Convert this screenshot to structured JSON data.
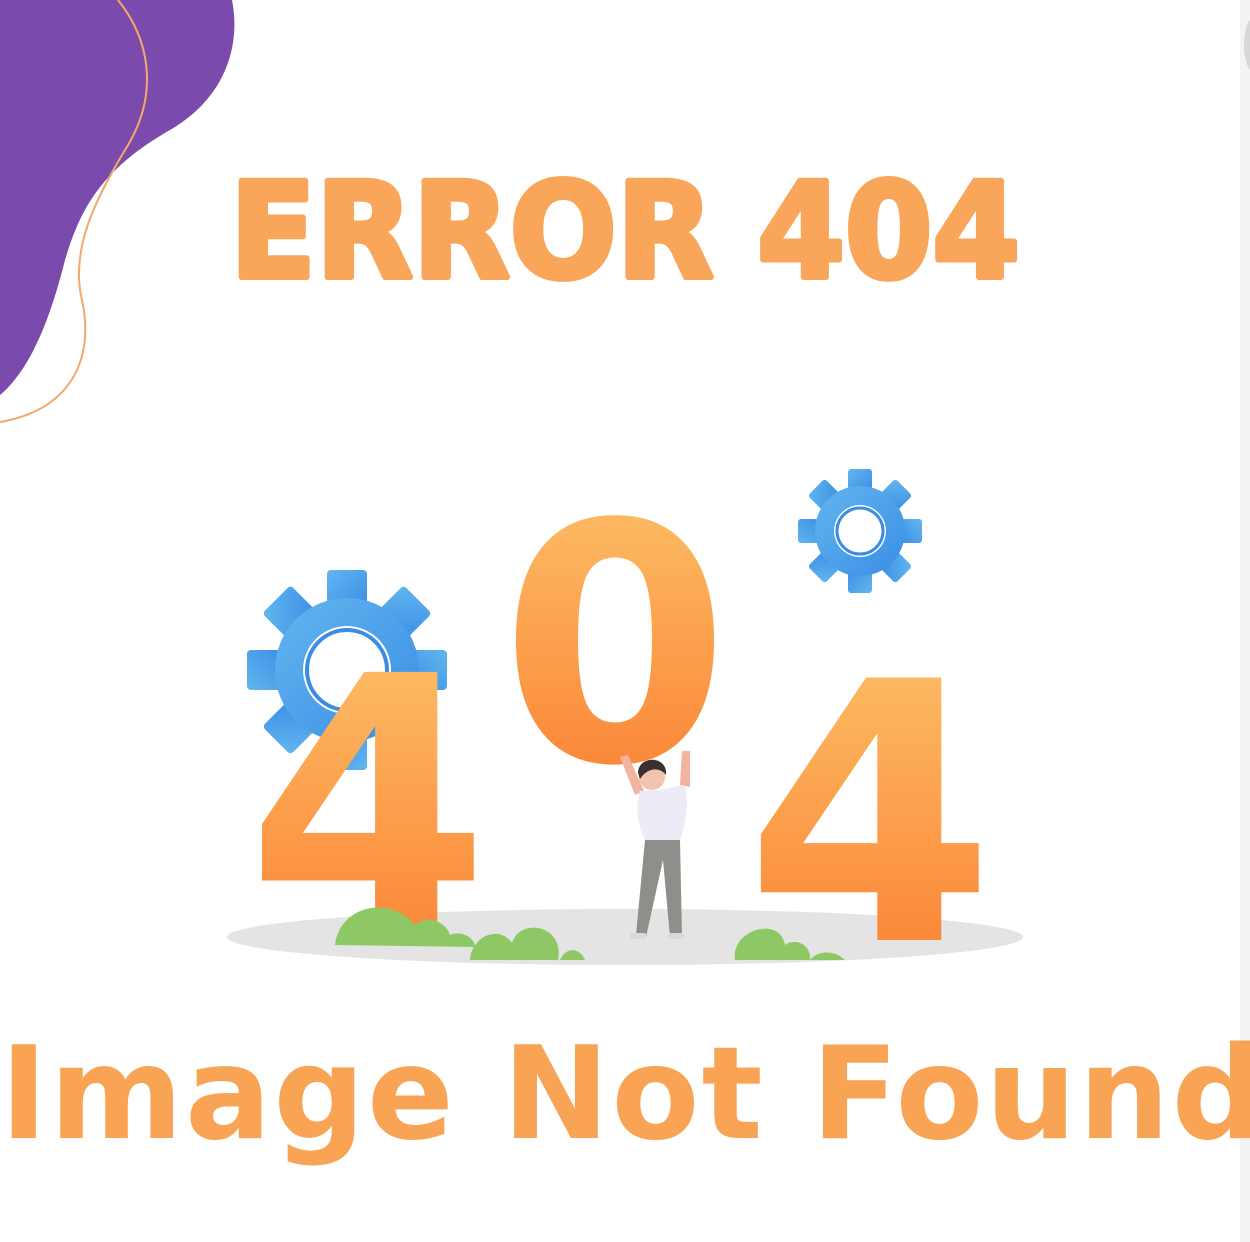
{
  "headline": {
    "text": "ERROR 404"
  },
  "illustration": {
    "digits": [
      "4",
      "0",
      "4"
    ],
    "icons": [
      "gear-icon",
      "gear-icon",
      "person-lifting-icon",
      "bush-icon"
    ]
  },
  "message": {
    "text": "Image Not Found"
  },
  "colors": {
    "headline": "#f9a65a",
    "subtitle": "#f9a454",
    "blob": "#7a4bad",
    "blob_outline": "#f2a96c",
    "digit_top": "#fcc56b",
    "digit_bottom": "#fb7a2e",
    "gear_light": "#62b6ef",
    "gear_dark": "#3a8de4",
    "bush": "#8dc865",
    "ground": "#e4e4e4"
  }
}
